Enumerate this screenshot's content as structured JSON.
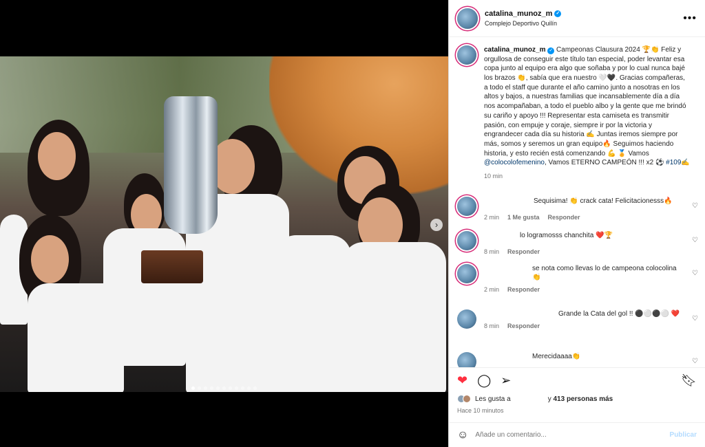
{
  "header": {
    "username": "catalina_munoz_m",
    "location": "Complejo Deportivo Quilín",
    "more": "•••"
  },
  "caption": {
    "username": "catalina_munoz_m",
    "text": "Campeonas Clausura 2024 🏆👏 Feliz y orgullosa de conseguir este título tan especial, poder levantar esa copa junto al equipo era algo que soñaba y por lo cual nunca bajé los brazos 👏, sabía que era nuestro 🤍🖤. Gracias compañeras, a todo el staff que durante el año camino junto a nosotras en los altos y bajos, a nuestras familias que incansablemente día a día nos acompañaban, a todo el pueblo albo y la gente que me brindó su cariño y apoyo !!! Representar esta camiseta es transmitir pasión, con empuje y coraje, siempre ir por la victoria y engrandecer cada día su historia ✍️ Juntas iremos siempre por más, somos y seremos un gran equipo🔥 Seguimos haciendo historia, y esto recién está comenzando 💪 🏅 Vamos ",
    "tag": "@colocolofemenino",
    "text2": ", Vamos ETERNO CAMPEÓN !!! x2 ⚽ ",
    "hashtag": "#109",
    "tail": "✍️",
    "time": "10 min"
  },
  "comments": [
    {
      "text": "Sequisima! 👏 crack cata! Felicitacionesss🔥",
      "time": "2 min",
      "likes": "1 Me gusta",
      "reply": "Responder"
    },
    {
      "text": "lo logramosss chanchita ❤️🏆",
      "time": "8 min",
      "reply": "Responder"
    },
    {
      "text": "se nota como llevas lo de campeona colocolina 👏",
      "time": "2 min",
      "reply": "Responder"
    },
    {
      "text": "Grande la Cata del gol !! ⚫⚪⚫⚪ ❤️",
      "time": "8 min",
      "reply": "Responder"
    },
    {
      "text": "Merecidaaaa👏"
    }
  ],
  "icons": {
    "like": "heart-filled-icon",
    "comment": "comment-icon",
    "share": "paper-plane-icon",
    "save": "bookmark-icon",
    "emoji": "smiley-icon",
    "next": "chevron-right-icon"
  },
  "likes": {
    "prefix": "Les gusta a",
    "suffix_pre": "y ",
    "count": "413 personas más"
  },
  "posted_ago": "Hace 10 minutos",
  "composer": {
    "placeholder": "Añade un comentario...",
    "post": "Publicar"
  },
  "colors": {
    "like": "#ff3040",
    "link": "#00376b",
    "verified": "#0095f6",
    "post_disabled": "#b3dbff"
  }
}
